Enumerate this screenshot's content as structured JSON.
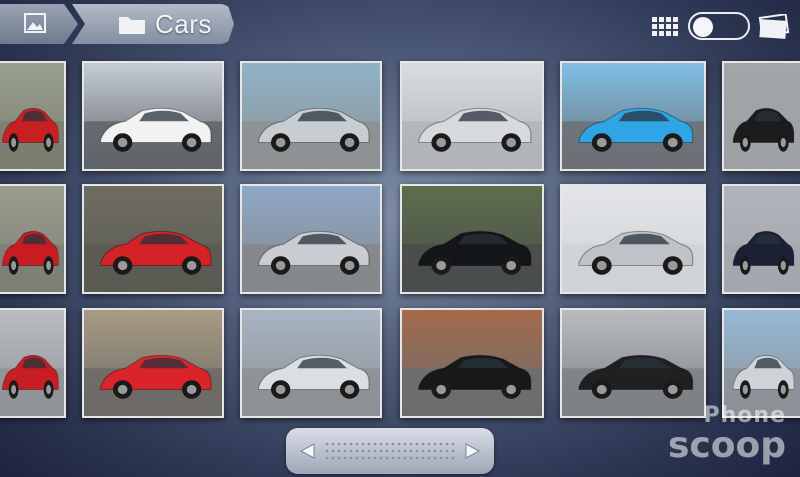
{
  "header": {
    "album_title": "Cars",
    "home_icon": "gallery-icon",
    "folder_icon": "folder-icon",
    "grid_view_icon": "grid-view-icon",
    "stack_view_icon": "stack-view-icon"
  },
  "view_toggle": {
    "mode": "grid"
  },
  "thumbnails": [
    {
      "label": "red Audi coupe",
      "sky": "#9aa08f",
      "ground": "#7b7e70",
      "car": "#c81f22"
    },
    {
      "label": "white BMW 1 series coupe",
      "sky": "#c6ccd6",
      "ground": "#5f6468",
      "car": "#f2f2f2"
    },
    {
      "label": "silver BMW 3 series sedan",
      "sky": "#8fb3c9",
      "ground": "#8d9192",
      "car": "#c8cdd2"
    },
    {
      "label": "silver BMW M3 front",
      "sky": "#d9dde1",
      "ground": "#b0b4b8",
      "car": "#d7dadd"
    },
    {
      "label": "blue BMW 6 series coupe",
      "sky": "#7fc0e5",
      "ground": "#6c7075",
      "car": "#2fa5e6"
    },
    {
      "label": "black BMW sedan",
      "sky": "#a3a6a8",
      "ground": "#9ea1a4",
      "car": "#1c1c1e"
    },
    {
      "label": "red Audi sedan",
      "sky": "#9a9d8e",
      "ground": "#7d7f74",
      "car": "#c91c20"
    },
    {
      "label": "red BMW coupe on track",
      "sky": "#6f6d62",
      "ground": "#5a5a54",
      "car": "#d42226"
    },
    {
      "label": "silver BMW 3 series coupe mountains",
      "sky": "#8fa8c8",
      "ground": "#85878a",
      "car": "#c9ccd0"
    },
    {
      "label": "black BMW coupe forest",
      "sky": "#5d6e4b",
      "ground": "#4a4c4e",
      "car": "#141518"
    },
    {
      "label": "silver BMW concept car",
      "sky": "#e3e5e8",
      "ground": "#cfd2d5",
      "car": "#bfc3c8"
    },
    {
      "label": "dark blue BMW coupe",
      "sky": "#b0b4ba",
      "ground": "#a3a7ad",
      "car": "#1b2034"
    },
    {
      "label": "red Audi sedan street",
      "sky": "#b9bcc0",
      "ground": "#8f9296",
      "car": "#c71d23"
    },
    {
      "label": "red BMW 1 series bridge",
      "sky": "#a89b84",
      "ground": "#6c6a66",
      "car": "#d9252a"
    },
    {
      "label": "silver BMW 3 series coupe",
      "sky": "#a9b5c4",
      "ground": "#8d9094",
      "car": "#dcdfe2"
    },
    {
      "label": "black BMW M3 canyon",
      "sky": "#a36a4a",
      "ground": "#6c6c70",
      "car": "#17181a"
    },
    {
      "label": "black BMW Z4 mountains",
      "sky": "#b8bcc0",
      "ground": "#7d8085",
      "car": "#1f2022"
    },
    {
      "label": "silver BMW Z4 roadster",
      "sky": "#96b9d6",
      "ground": "#8c9096",
      "car": "#cfd3d8"
    }
  ],
  "scrubber": {
    "left_arrow_icon": "arrow-left-icon",
    "right_arrow_icon": "arrow-right-icon"
  },
  "watermark": {
    "line1": "Phone",
    "line2": "scoop"
  }
}
